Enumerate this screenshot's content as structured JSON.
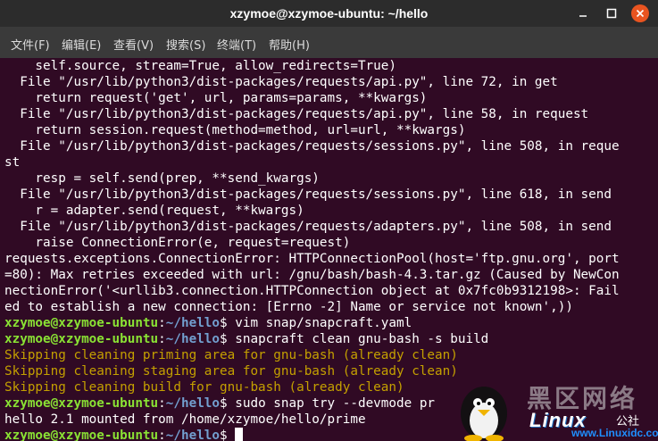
{
  "window": {
    "title": "xzymoe@xzymoe-ubuntu: ~/hello",
    "colors": {
      "titlebar": "#2c2c2c",
      "menubar": "#3a3a3a",
      "background": "#300a24",
      "close_button": "#e95420",
      "prompt_user": "#8ae234",
      "prompt_path": "#729fcf",
      "warning_text": "#c4a000"
    },
    "buttons": {
      "minimize_icon": "minimize-icon",
      "maximize_icon": "maximize-icon",
      "close_icon": "close-icon"
    }
  },
  "menubar": {
    "items": [
      "文件(F)",
      "编辑(E)",
      "查看(V)",
      "搜索(S)",
      "终端(T)",
      "帮助(H)"
    ]
  },
  "terminal": {
    "lines": [
      [
        {
          "t": "    self.source, stream=True, allow_redirects=True)",
          "c": "plain"
        }
      ],
      [
        {
          "t": "  File \"/usr/lib/python3/dist-packages/requests/api.py\", line 72, in get",
          "c": "plain"
        }
      ],
      [
        {
          "t": "    return request('get', url, params=params, **kwargs)",
          "c": "plain"
        }
      ],
      [
        {
          "t": "  File \"/usr/lib/python3/dist-packages/requests/api.py\", line 58, in request",
          "c": "plain"
        }
      ],
      [
        {
          "t": "    return session.request(method=method, url=url, **kwargs)",
          "c": "plain"
        }
      ],
      [
        {
          "t": "  File \"/usr/lib/python3/dist-packages/requests/sessions.py\", line 508, in reque",
          "c": "plain"
        }
      ],
      [
        {
          "t": "st",
          "c": "plain"
        }
      ],
      [
        {
          "t": "    resp = self.send(prep, **send_kwargs)",
          "c": "plain"
        }
      ],
      [
        {
          "t": "  File \"/usr/lib/python3/dist-packages/requests/sessions.py\", line 618, in send",
          "c": "plain"
        }
      ],
      [
        {
          "t": "    r = adapter.send(request, **kwargs)",
          "c": "plain"
        }
      ],
      [
        {
          "t": "  File \"/usr/lib/python3/dist-packages/requests/adapters.py\", line 508, in send",
          "c": "plain"
        }
      ],
      [
        {
          "t": "    raise ConnectionError(e, request=request)",
          "c": "plain"
        }
      ],
      [
        {
          "t": "requests.exceptions.ConnectionError: HTTPConnectionPool(host='ftp.gnu.org', port",
          "c": "plain"
        }
      ],
      [
        {
          "t": "=80): Max retries exceeded with url: /gnu/bash/bash-4.3.tar.gz (Caused by NewCon",
          "c": "plain"
        }
      ],
      [
        {
          "t": "nectionError('<urllib3.connection.HTTPConnection object at 0x7fc0b9312198>: Fail",
          "c": "plain"
        }
      ],
      [
        {
          "t": "ed to establish a new connection: [Errno -2] Name or service not known',))",
          "c": "plain"
        }
      ],
      [
        {
          "t": "xzymoe@xzymoe-ubuntu",
          "c": "green"
        },
        {
          "t": ":",
          "c": "plain"
        },
        {
          "t": "~/hello",
          "c": "blue"
        },
        {
          "t": "$ vim snap/snapcraft.yaml",
          "c": "plain"
        }
      ],
      [
        {
          "t": "xzymoe@xzymoe-ubuntu",
          "c": "green"
        },
        {
          "t": ":",
          "c": "plain"
        },
        {
          "t": "~/hello",
          "c": "blue"
        },
        {
          "t": "$ snapcraft clean gnu-bash -s build",
          "c": "plain"
        }
      ],
      [
        {
          "t": "Skipping cleaning priming area for gnu-bash (already clean)",
          "c": "yellow"
        }
      ],
      [
        {
          "t": "Skipping cleaning staging area for gnu-bash (already clean)",
          "c": "yellow"
        }
      ],
      [
        {
          "t": "Skipping cleaning build for gnu-bash (already clean)",
          "c": "yellow"
        }
      ],
      [
        {
          "t": "xzymoe@xzymoe-ubuntu",
          "c": "green"
        },
        {
          "t": ":",
          "c": "plain"
        },
        {
          "t": "~/hello",
          "c": "blue"
        },
        {
          "t": "$ sudo snap try --devmode pr",
          "c": "plain"
        }
      ],
      [
        {
          "t": "hello 2.1 mounted from /home/xzymoe/hello/prime",
          "c": "plain"
        }
      ],
      [
        {
          "t": "xzymoe@xzymoe-ubuntu",
          "c": "green"
        },
        {
          "t": ":",
          "c": "plain"
        },
        {
          "t": "~/hello",
          "c": "blue"
        },
        {
          "t": "$ ",
          "c": "plain"
        },
        {
          "t": "",
          "c": "cursor"
        }
      ]
    ]
  },
  "watermark": {
    "chinese": "黑区网络",
    "brand": "Linux",
    "sub": "公社",
    "url": "www.Linuxidc.com",
    "logo_icon": "tux-penguin-icon"
  }
}
